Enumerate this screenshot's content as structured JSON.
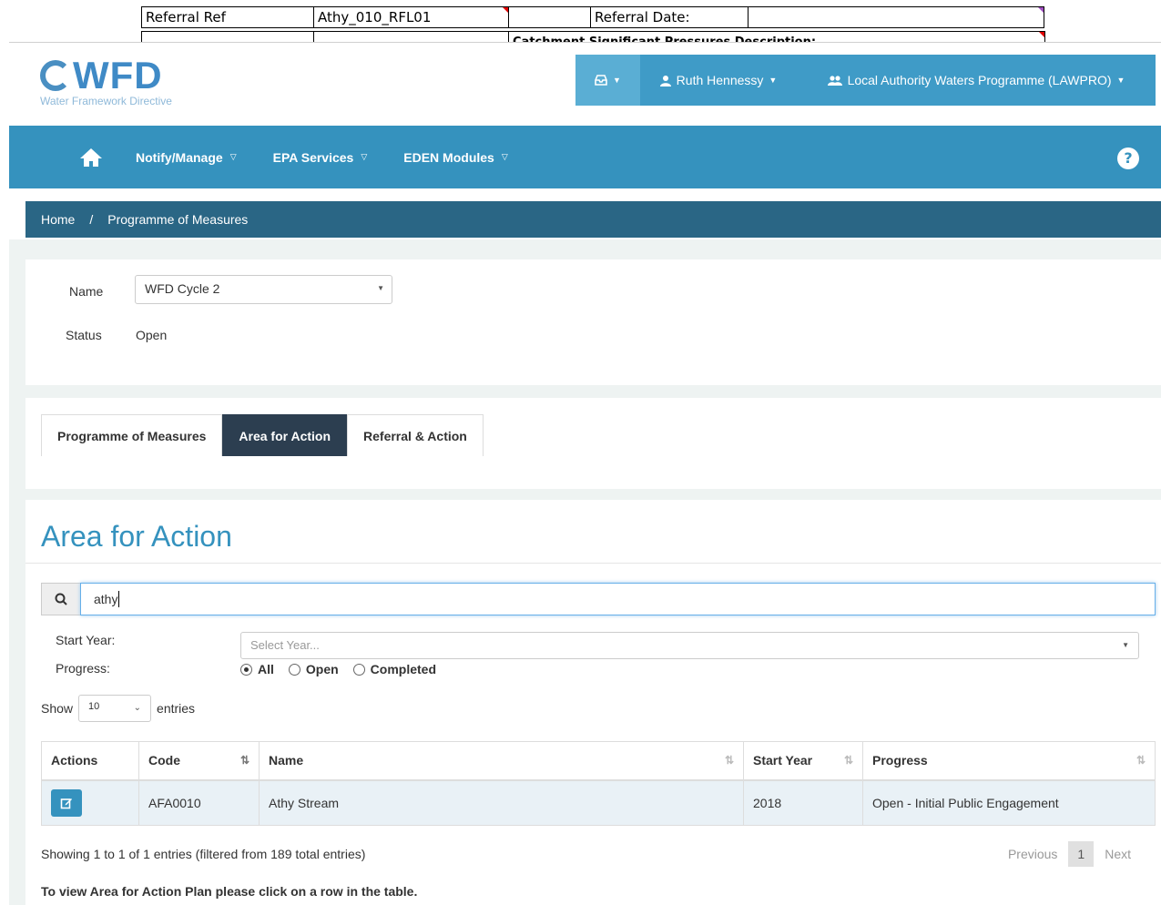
{
  "spreadsheet": {
    "row1": [
      "Referral Ref",
      "Athy_010_RFL01",
      "",
      "Referral Date:",
      ""
    ],
    "row2": [
      "",
      "",
      "Catchment Significant Pressures Description:"
    ]
  },
  "logo": {
    "text": "WFD",
    "subtitle": "Water Framework Directive"
  },
  "userbar": {
    "user": "Ruth Hennessy",
    "organisation": "Local Authority Waters Programme (LAWPRO)"
  },
  "nav": {
    "items": [
      "Notify/Manage",
      "EPA Services",
      "EDEN Modules"
    ],
    "help": "?"
  },
  "breadcrumb": {
    "home": "Home",
    "separator": "/",
    "current": "Programme of Measures"
  },
  "programme": {
    "name_label": "Name",
    "name_value": "WFD Cycle 2",
    "status_label": "Status",
    "status_value": "Open"
  },
  "tabs": [
    "Programme of Measures",
    "Area for Action",
    "Referral & Action"
  ],
  "active_tab": 1,
  "section": {
    "title": "Area for Action",
    "search_value": "athy",
    "start_year_label": "Start Year:",
    "start_year_placeholder": "Select Year...",
    "progress_label": "Progress:",
    "progress_options": [
      "All",
      "Open",
      "Completed"
    ],
    "progress_selected": "All",
    "show_label": "Show",
    "entries_value": "10",
    "entries_label": "entries"
  },
  "table": {
    "columns": [
      "Actions",
      "Code",
      "Name",
      "Start Year",
      "Progress"
    ],
    "rows": [
      {
        "code": "AFA0010",
        "name": "Athy Stream",
        "start_year": "2018",
        "progress": "Open - Initial Public Engagement"
      }
    ]
  },
  "footer": {
    "info": "Showing 1 to 1 of 1 entries (filtered from 189 total entries)",
    "previous": "Previous",
    "page": "1",
    "next": "Next",
    "note": "To view Area for Action Plan please click on a row in the table."
  },
  "colors": {
    "primary": "#3592be",
    "breadcrumb": "#2a6685",
    "active_tab": "#2c3e50"
  }
}
